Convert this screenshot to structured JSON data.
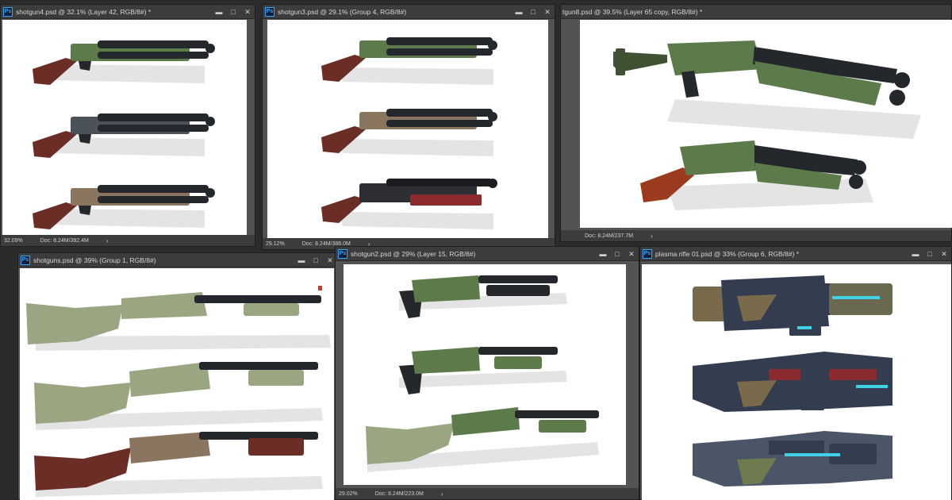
{
  "windows": [
    {
      "title": "shotgun4.psd @ 32.1% (Layer 42, RGB/8#) *",
      "zoom": "32.09%",
      "doc": "Doc: 8.24M/392.4M",
      "arrow": "›",
      "app_badge": "Ps"
    },
    {
      "title": "shotgun3.psd @ 29.1% (Group 4, RGB/8#)",
      "zoom": "29.12%",
      "doc": "Doc: 8.24M/386.0M",
      "arrow": "›",
      "app_badge": "Ps"
    },
    {
      "title": "tgun8.psd @ 39.5% (Layer 65 copy, RGB/8#) *",
      "zoom": "",
      "doc": "Doc: 8.24M/237.7M",
      "arrow": "›",
      "app_badge": ""
    },
    {
      "title": "shotguns.psd @ 39% (Group 1, RGB/8#)",
      "zoom": "",
      "doc": "",
      "arrow": "",
      "app_badge": "Ps"
    },
    {
      "title": "shotgun2.psd @ 29% (Layer 15, RGB/8#)",
      "zoom": "29.02%",
      "doc": "Doc: 8.24M/223.0M",
      "arrow": "›",
      "app_badge": "Ps"
    },
    {
      "title": "plasma rifle 01.psd @ 33% (Group 6, RGB/8#) *",
      "zoom": "",
      "doc": "",
      "arrow": "",
      "app_badge": "Ps"
    }
  ],
  "window_controls": {
    "minimize": "▬",
    "maximize": "□",
    "close": "✕"
  },
  "colors": {
    "ps_chrome": "#3c3c3c",
    "workspace": "#535353",
    "olive_green": "#5c7a4a",
    "light_olive": "#9aa582",
    "gunmetal": "#4c525a",
    "tan": "#8a7660",
    "walnut": "#6b2e26",
    "barrel_black": "#24272b",
    "plasma_navy": "#343d4f",
    "plasma_cyan": "#3fd1e6",
    "plasma_red": "#8b2a2f"
  }
}
